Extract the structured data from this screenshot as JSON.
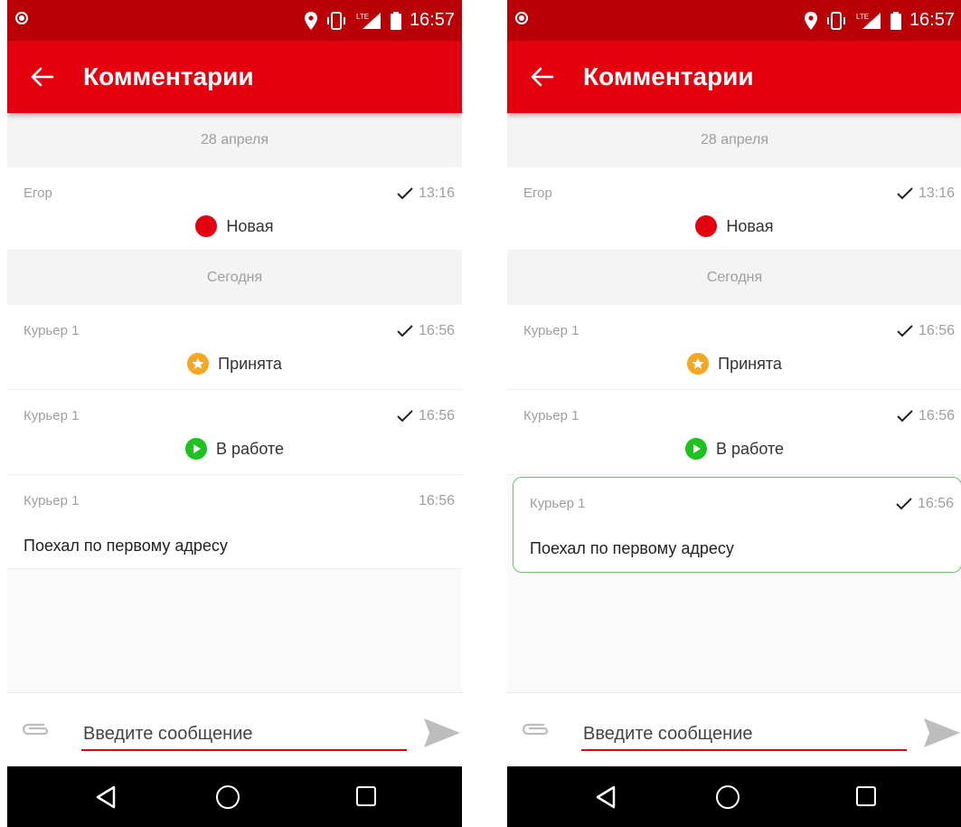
{
  "app": {
    "title": "Комментарии"
  },
  "statusbar": {
    "time": "16:57",
    "network": "LTE"
  },
  "feed": {
    "date_1": "28 апреля",
    "date_2": "Сегодня",
    "messages": [
      {
        "author": "Егор",
        "time": "13:16",
        "status": "Новая",
        "status_color": "#e3000f"
      },
      {
        "author": "Курьер 1",
        "time": "16:56",
        "status": "Принята",
        "status_color": "#f5a623"
      },
      {
        "author": "Курьер 1",
        "time": "16:56",
        "status": "В работе",
        "status_color": "#1ec21e"
      },
      {
        "author": "Курьер 1",
        "time": "16:56",
        "text": "Поехал по первому адресу"
      }
    ]
  },
  "composer": {
    "placeholder": "Введите сообщение"
  },
  "colors": {
    "accent": "#e3000f",
    "statusbar": "#b80006",
    "highlight_border": "#6cbf6c"
  },
  "icons": {
    "back": "arrow-left-icon",
    "attach": "paperclip-icon",
    "send": "send-icon",
    "check": "check-icon"
  }
}
